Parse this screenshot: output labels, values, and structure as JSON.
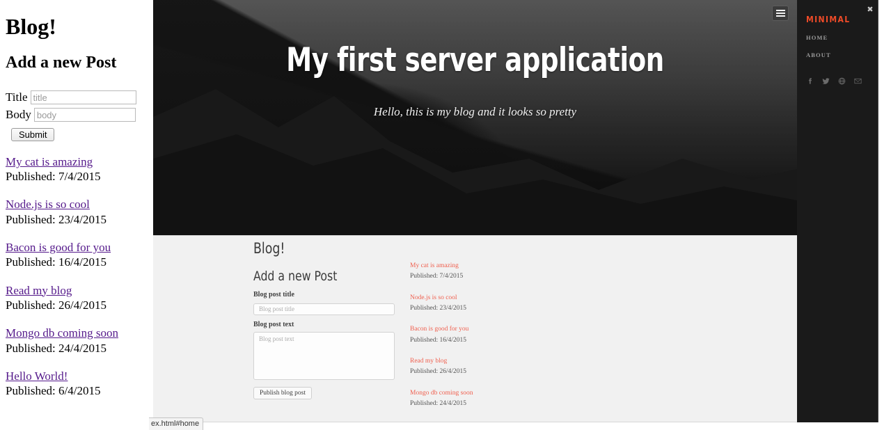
{
  "plain_page": {
    "title": "Blog!",
    "subtitle": "Add a new Post",
    "form": {
      "title_label": "Title",
      "title_placeholder": "title",
      "body_label": "Body",
      "body_placeholder": "body",
      "submit_label": "Submit"
    },
    "published_prefix": "Published: ",
    "posts": [
      {
        "title": "My cat is amazing",
        "published": "Published: 7/4/2015"
      },
      {
        "title": "Node.js is so cool",
        "published": "Published: 23/4/2015"
      },
      {
        "title": "Bacon is good for you",
        "published": "Published: 16/4/2015"
      },
      {
        "title": "Read my blog",
        "published": "Published: 26/4/2015"
      },
      {
        "title": "Mongo db coming soon",
        "published": "Published: 24/4/2015"
      },
      {
        "title": "Hello World!",
        "published": "Published: 6/4/2015"
      }
    ],
    "link_color": "#551a8b"
  },
  "site": {
    "hero": {
      "title": "My first server application",
      "subtitle": "Hello, this is my blog and it looks so pretty",
      "menu_toggle_icon": "hamburger-icon"
    },
    "content": {
      "heading": "Blog!",
      "subheading": "Add a new Post",
      "form": {
        "title_label": "Blog post title",
        "title_placeholder": "Blog post title",
        "text_label": "Blog post text",
        "text_placeholder": "Blog post text",
        "submit_label": "Publish blog post"
      },
      "posts": [
        {
          "title": "My cat is amazing",
          "published": "Published: 7/4/2015"
        },
        {
          "title": "Node.js is so cool",
          "published": "Published: 23/4/2015"
        },
        {
          "title": "Bacon is good for you",
          "published": "Published: 16/4/2015"
        },
        {
          "title": "Read my blog",
          "published": "Published: 26/4/2015"
        },
        {
          "title": "Mongo db coming soon",
          "published": "Published: 24/4/2015"
        }
      ],
      "link_color": "#f05f4e"
    },
    "sidebar": {
      "brand": "MINIMAL",
      "close_label": "✖",
      "nav": [
        {
          "label": "HOME"
        },
        {
          "label": "ABOUT"
        }
      ],
      "social": [
        {
          "name": "facebook-icon"
        },
        {
          "name": "twitter-icon"
        },
        {
          "name": "dribbble-icon"
        },
        {
          "name": "email-icon"
        }
      ],
      "brand_color": "#ef4b28",
      "background_color": "#1a1a1a"
    }
  },
  "browser": {
    "status_text": "ex.html#home"
  }
}
